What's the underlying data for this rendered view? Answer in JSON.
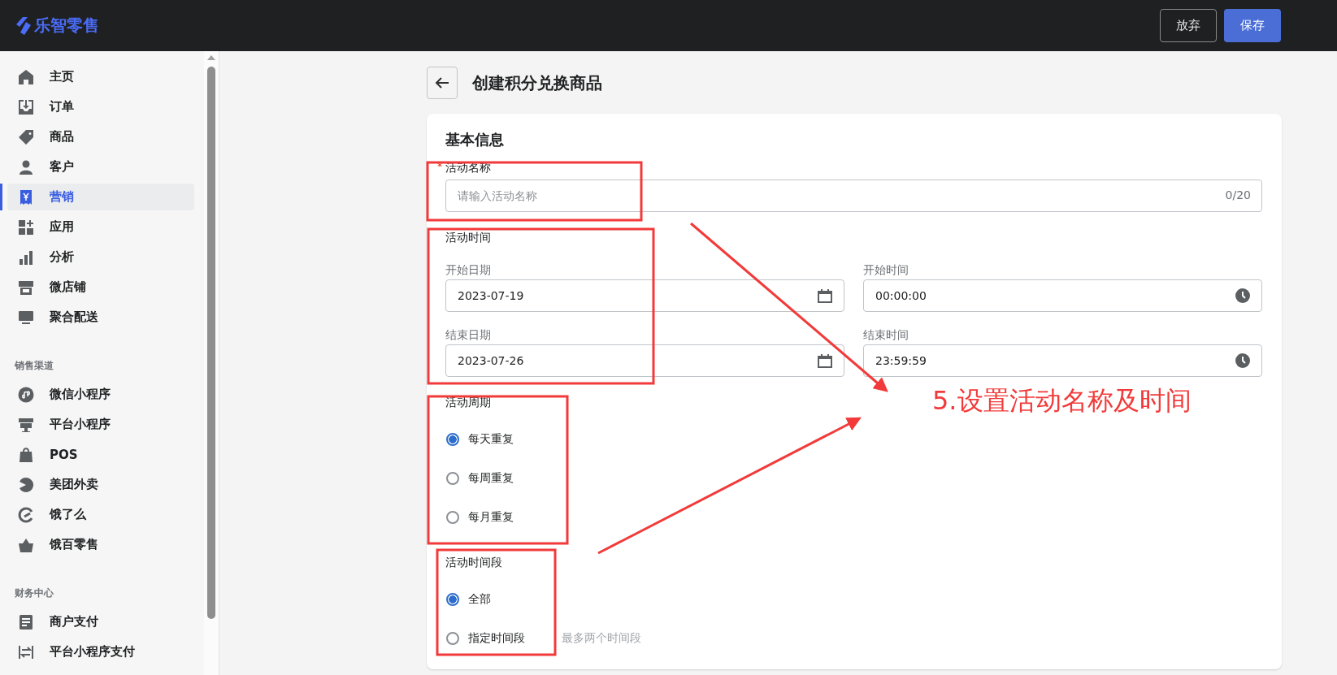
{
  "app": {
    "logo": "乐智零售"
  },
  "header": {
    "buttons": [
      {
        "label": "放弃",
        "kind": "secondary"
      },
      {
        "label": "保存",
        "kind": "primary"
      }
    ]
  },
  "sidebar": {
    "sections": [
      {
        "items": [
          {
            "label": "主页",
            "selected": false
          },
          {
            "label": "订单",
            "selected": false
          },
          {
            "label": "商品",
            "selected": false
          },
          {
            "label": "客户",
            "selected": false
          },
          {
            "label": "营销",
            "selected": true
          },
          {
            "label": "应用",
            "selected": false
          },
          {
            "label": "分析",
            "selected": false
          },
          {
            "label": "微店铺",
            "selected": false
          },
          {
            "label": "聚合配送",
            "selected": false
          }
        ]
      },
      {
        "title": "销售渠道",
        "items": [
          {
            "label": "微信小程序",
            "selected": false
          },
          {
            "label": "平台小程序",
            "selected": false
          },
          {
            "label": "POS",
            "selected": false
          },
          {
            "label": "美团外卖",
            "selected": false
          },
          {
            "label": "饿了么",
            "selected": false
          },
          {
            "label": "饿百零售",
            "selected": false
          }
        ]
      },
      {
        "title": "财务中心",
        "items": [
          {
            "label": "商户支付",
            "selected": false
          },
          {
            "label": "平台小程序支付",
            "selected": false
          }
        ]
      }
    ]
  },
  "page": {
    "title": "创建积分兑换商品"
  },
  "card": {
    "title": "基本信息",
    "name_field": {
      "label": "活动名称",
      "required_mark": "*",
      "placeholder": "请输入活动名称",
      "counter": "0/20"
    },
    "time": {
      "label": "活动时间",
      "fields": [
        {
          "label": "开始日期",
          "value": "2023-07-19",
          "kind": "date"
        },
        {
          "label": "开始时间",
          "value": "00:00:00",
          "kind": "time"
        },
        {
          "label": "结束日期",
          "value": "2023-07-26",
          "kind": "date"
        },
        {
          "label": "结束时间",
          "value": "23:59:59",
          "kind": "time"
        }
      ]
    },
    "cycle": {
      "label": "活动周期",
      "options": [
        {
          "label": "每天重复",
          "selected": true
        },
        {
          "label": "每周重复",
          "selected": false
        },
        {
          "label": "每月重复",
          "selected": false
        }
      ]
    },
    "period": {
      "label": "活动时间段",
      "options": [
        {
          "label": "全部",
          "selected": true
        },
        {
          "label": "指定时间段",
          "selected": false,
          "hint": "最多两个时间段"
        }
      ]
    }
  },
  "annotation": {
    "caption": "5.设置活动名称及时间"
  }
}
